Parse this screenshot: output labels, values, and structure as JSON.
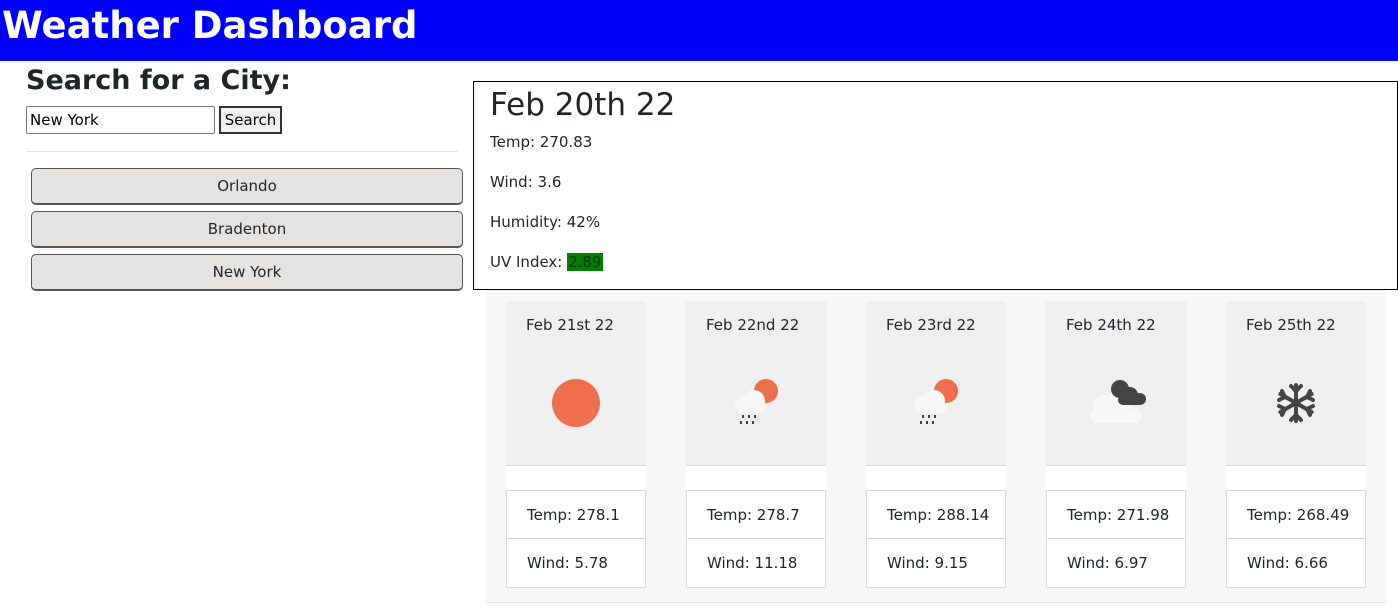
{
  "header": {
    "title": "Weather Dashboard"
  },
  "search": {
    "title": "Search for a City:",
    "input_value": "New York",
    "button_label": "Search"
  },
  "history": [
    {
      "label": "Orlando"
    },
    {
      "label": "Bradenton"
    },
    {
      "label": "New York"
    }
  ],
  "current": {
    "date": "Feb 20th 22",
    "temp": "Temp: 270.83",
    "wind": "Wind: 3.6",
    "humidity": "Humidity: 42%",
    "uv_label": "UV Index: ",
    "uv_value": "2.89",
    "uv_color": "#008000"
  },
  "forecast": [
    {
      "date": "Feb 21st 22",
      "icon": "sun-icon",
      "temp": "Temp: 278.1",
      "wind": "Wind: 5.78"
    },
    {
      "date": "Feb 22nd 22",
      "icon": "sun-rain-icon",
      "temp": "Temp: 278.7",
      "wind": "Wind: 11.18"
    },
    {
      "date": "Feb 23rd 22",
      "icon": "sun-rain-icon",
      "temp": "Temp: 288.14",
      "wind": "Wind: 9.15"
    },
    {
      "date": "Feb 24th 22",
      "icon": "clouds-icon",
      "temp": "Temp: 271.98",
      "wind": "Wind: 6.97"
    },
    {
      "date": "Feb 25th 22",
      "icon": "snowflake-icon",
      "temp": "Temp: 268.49",
      "wind": "Wind: 6.66"
    }
  ],
  "colors": {
    "header_bg": "#0000ff",
    "sun": "#ee6e4e",
    "dark_cloud": "#444444",
    "uv_good": "#008000"
  }
}
